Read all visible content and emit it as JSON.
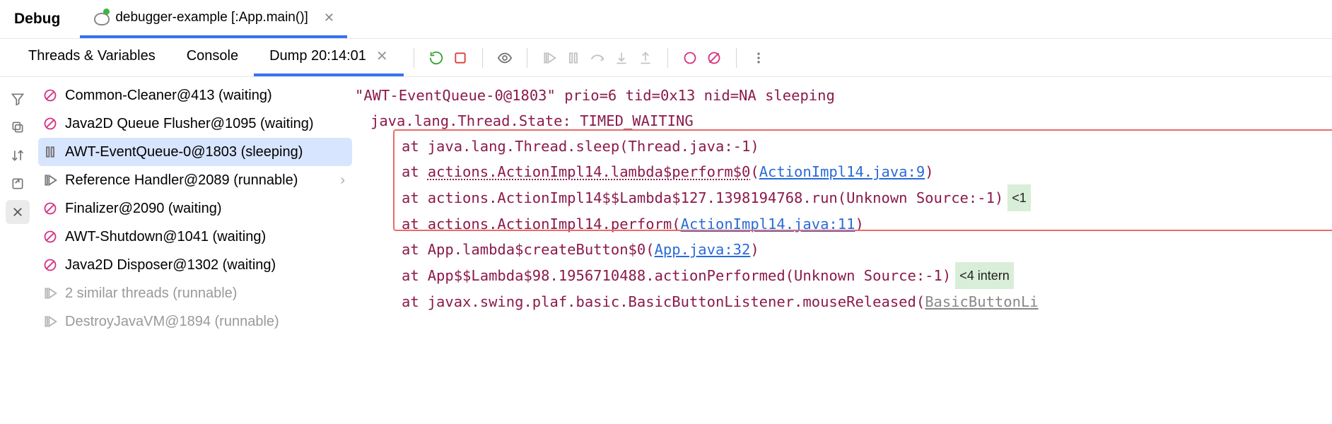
{
  "titlebar": {
    "label": "Debug",
    "tab": "debugger-example [:App.main()]"
  },
  "tooltabs": {
    "t1": "Threads & Variables",
    "t2": "Console",
    "t3": "Dump 20:14:01"
  },
  "threads": [
    {
      "label": "Common-Cleaner@413 (waiting)",
      "icon": "slash"
    },
    {
      "label": "Java2D Queue Flusher@1095 (waiting)",
      "icon": "slash"
    },
    {
      "label": "AWT-EventQueue-0@1803 (sleeping)",
      "icon": "pause",
      "selected": true
    },
    {
      "label": "Reference Handler@2089 (runnable)",
      "icon": "run",
      "chev": true
    },
    {
      "label": "Finalizer@2090 (waiting)",
      "icon": "slash"
    },
    {
      "label": "AWT-Shutdown@1041 (waiting)",
      "icon": "slash"
    },
    {
      "label": "Java2D Disposer@1302 (waiting)",
      "icon": "slash"
    },
    {
      "label": "2 similar threads (runnable)",
      "icon": "run",
      "dim": true
    },
    {
      "label": "DestroyJavaVM@1894 (runnable)",
      "icon": "run",
      "dim": true
    }
  ],
  "stack": {
    "header": "\"AWT-EventQueue-0@1803\" prio=6 tid=0x13 nid=NA sleeping",
    "state": "java.lang.Thread.State: TIMED_WAITING",
    "frames": [
      {
        "at": "at",
        "loc": "java.lang.Thread.sleep",
        "paren_pre": "(Thread.java:-1)",
        "link": "",
        "paren_post": ""
      },
      {
        "at": "at",
        "loc_du": "actions.ActionImpl14.lambda$perform$0",
        "paren_pre": "(",
        "link": "ActionImpl14.java:9",
        "paren_post": ")"
      },
      {
        "at": "at",
        "loc": "actions.ActionImpl14$$Lambda$127.1398194768.run(Unknown Source:-1)",
        "badge": "<1"
      },
      {
        "at": "at",
        "loc": "actions.ActionImpl14.perform",
        "paren_pre": "(",
        "link": "ActionImpl14.java:11",
        "paren_post": ")"
      },
      {
        "at": "at",
        "loc": "App.lambda$createButton$0",
        "paren_pre": "(",
        "link": "App.java:32",
        "paren_post": ")"
      },
      {
        "at": "at",
        "loc": "App$$Lambda$98.1956710488.actionPerformed(Unknown Source:-1)",
        "badge": "<4 intern"
      },
      {
        "at": "at",
        "loc": "javax.swing.plaf.basic.BasicButtonListener.mouseReleased",
        "paren_pre": "(",
        "grey_link": "BasicButtonLi"
      }
    ]
  }
}
